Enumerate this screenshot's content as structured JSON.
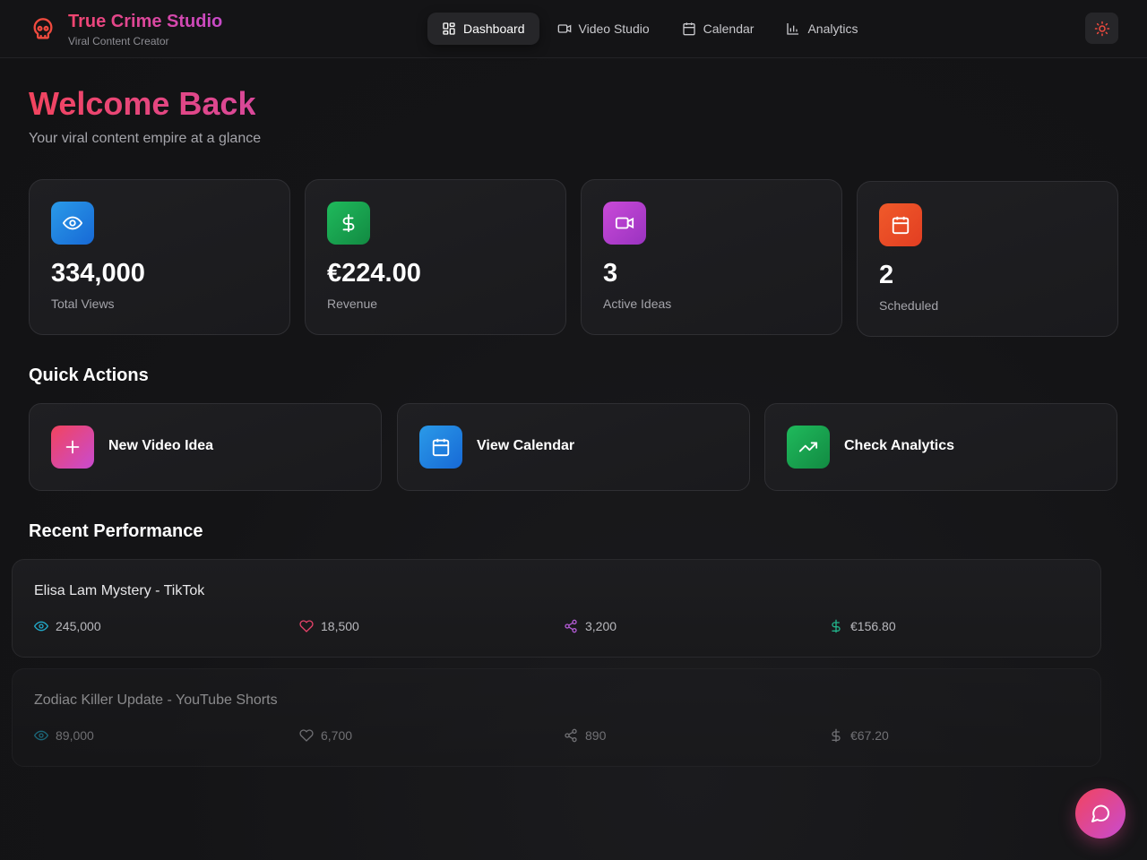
{
  "brand": {
    "title": "True Crime Studio",
    "subtitle": "Viral Content Creator",
    "icon": "skull-icon"
  },
  "nav": {
    "items": [
      {
        "label": "Dashboard",
        "icon": "dashboard-grid-icon",
        "active": true
      },
      {
        "label": "Video Studio",
        "icon": "video-camera-icon",
        "active": false
      },
      {
        "label": "Calendar",
        "icon": "calendar-icon",
        "active": false
      },
      {
        "label": "Analytics",
        "icon": "bar-chart-icon",
        "active": false
      }
    ],
    "theme_toggle_icon": "sun-icon"
  },
  "header": {
    "title": "Welcome Back",
    "subtitle": "Your viral content empire at a glance"
  },
  "stats": [
    {
      "value": "334,000",
      "label": "Total Views",
      "icon": "eye-icon",
      "color": "#1e88e5"
    },
    {
      "value": "€224.00",
      "label": "Revenue",
      "icon": "dollar-icon",
      "color": "#16a34a"
    },
    {
      "value": "3",
      "label": "Active Ideas",
      "icon": "video-camera-icon",
      "color": "#b63fd0"
    },
    {
      "value": "2",
      "label": "Scheduled",
      "icon": "calendar-icon",
      "color": "#e8502a"
    }
  ],
  "quick_actions": {
    "title": "Quick Actions",
    "items": [
      {
        "label": "New Video Idea",
        "icon": "plus-icon"
      },
      {
        "label": "View Calendar",
        "icon": "calendar-icon"
      },
      {
        "label": "Check Analytics",
        "icon": "trending-up-icon"
      }
    ]
  },
  "performance": {
    "title": "Recent Performance",
    "items": [
      {
        "title": "Elisa Lam Mystery - TikTok",
        "views": "245,000",
        "likes": "18,500",
        "shares": "3,200",
        "revenue": "€156.80"
      },
      {
        "title": "Zodiac Killer Update - YouTube Shorts",
        "views": "89,000",
        "likes": "6,700",
        "shares": "890",
        "revenue": "€67.20"
      }
    ]
  },
  "colors": {
    "accent_pink": "#f2445e",
    "accent_purple": "#c84bd1",
    "views": "#22a8c8",
    "likes": "#e8436a",
    "shares": "#b45bd6",
    "revenue": "#22b38a"
  },
  "chat_icon": "chat-bubble-icon"
}
